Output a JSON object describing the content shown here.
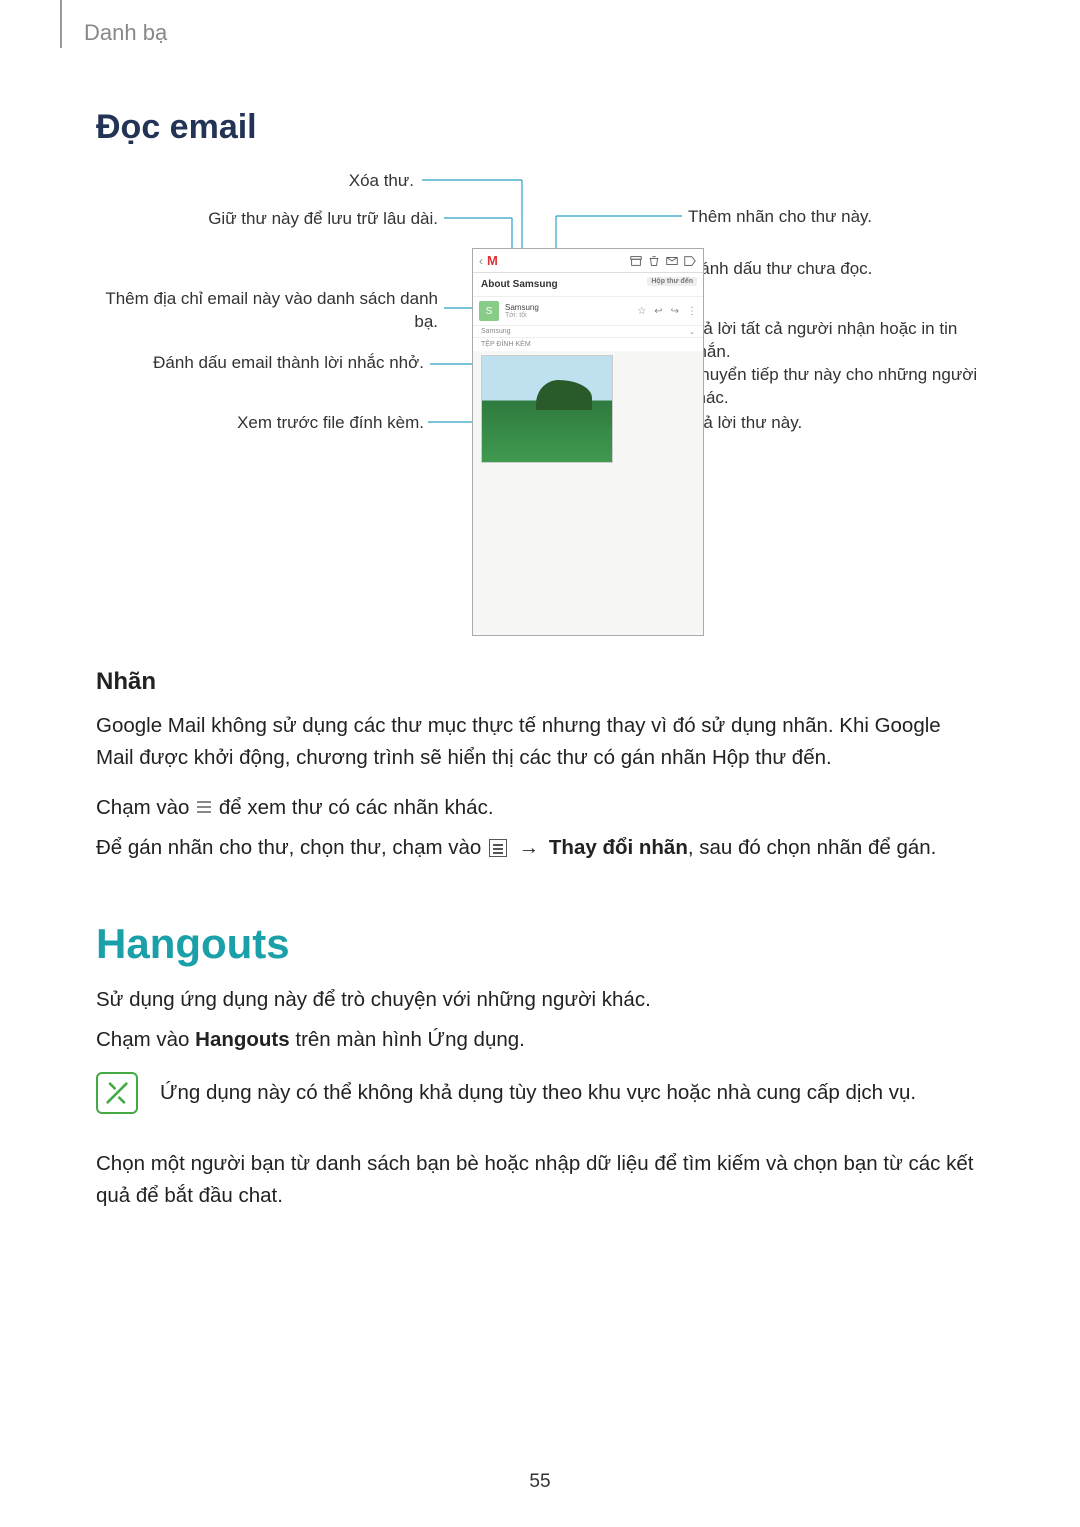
{
  "breadcrumb": "Danh bạ",
  "section_read_email": "Đọc email",
  "callouts": {
    "delete": "Xóa thư.",
    "archive": "Giữ thư này để lưu trữ lâu dài.",
    "add_contact": "Thêm địa chỉ email này vào danh sách danh bạ.",
    "reminder": "Đánh dấu email thành lời nhắc nhở.",
    "preview_attach": "Xem trước file đính kèm.",
    "add_label": "Thêm nhãn cho thư này.",
    "mark_unread": "Đánh dấu thư chưa đọc.",
    "reply_all": "Trả lời tất cả người nhận hoặc in tin nhắn.",
    "forward": "Chuyển tiếp thư này cho những người khác.",
    "reply": "Trả lời thư này."
  },
  "phone": {
    "subject": "About Samsung",
    "inbox_chip": "Hộp thư đến",
    "sender": "Samsung",
    "to": "Tới: tôi",
    "expand_sender": "Samsung",
    "attach_label": "TỆP ĐÍNH KÈM"
  },
  "labels": {
    "heading": "Nhãn",
    "para1": "Google Mail không sử dụng các thư mục thực tế nhưng thay vì đó sử dụng nhãn. Khi Google Mail được khởi động, chương trình sẽ hiển thị các thư có gán nhãn Hộp thư đến.",
    "para2_pre": "Chạm vào",
    "para2_post": "để xem thư có các nhãn khác.",
    "para3_pre": "Để gán nhãn cho thư, chọn thư, chạm vào",
    "para3_arrow": "→",
    "para3_bold": "Thay đổi nhãn",
    "para3_post": ", sau đó chọn nhãn để gán."
  },
  "hangouts": {
    "heading": "Hangouts",
    "p1": "Sử dụng ứng dụng này để trò chuyện với những người khác.",
    "p2_pre": "Chạm vào ",
    "p2_bold": "Hangouts",
    "p2_post": " trên màn hình Ứng dụng.",
    "note": "Ứng dụng này có thể không khả dụng tùy theo khu vực hoặc nhà cung cấp dịch vụ.",
    "p3": "Chọn một người bạn từ danh sách bạn bè hoặc nhập dữ liệu để tìm kiếm và chọn bạn từ các kết quả để bắt đầu chat."
  },
  "page_number": "55"
}
